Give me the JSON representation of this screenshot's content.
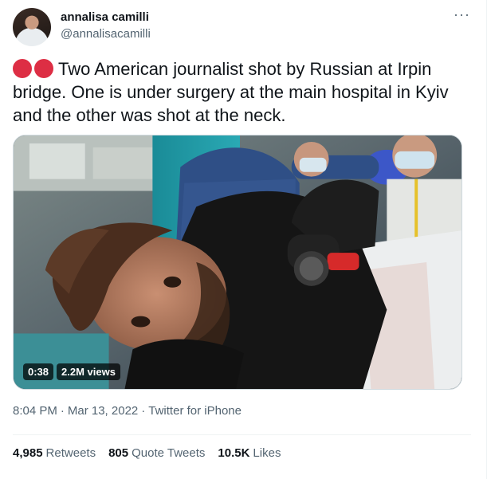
{
  "author": {
    "display_name": "annalisa camilli",
    "handle": "@annalisacamilli"
  },
  "more_menu": "···",
  "tweet": {
    "emoji": "red-circle-icon",
    "text": "Two American journalist shot by Russian at Irpin bridge. One is under surgery at the main hospital in Kyiv and the other was shot at the neck."
  },
  "media": {
    "duration": "0:38",
    "views": "2.2M views"
  },
  "meta": {
    "time": "8:04 PM",
    "date": "Mar 13, 2022",
    "source": "Twitter for iPhone",
    "separator": "·"
  },
  "stats": {
    "retweets_count": "4,985",
    "retweets_label": "Retweets",
    "quotes_count": "805",
    "quotes_label": "Quote Tweets",
    "likes_count": "10.5K",
    "likes_label": "Likes"
  },
  "colors": {
    "text": "#0f1419",
    "secondary": "#536471",
    "red_circle": "#dd2e44"
  }
}
